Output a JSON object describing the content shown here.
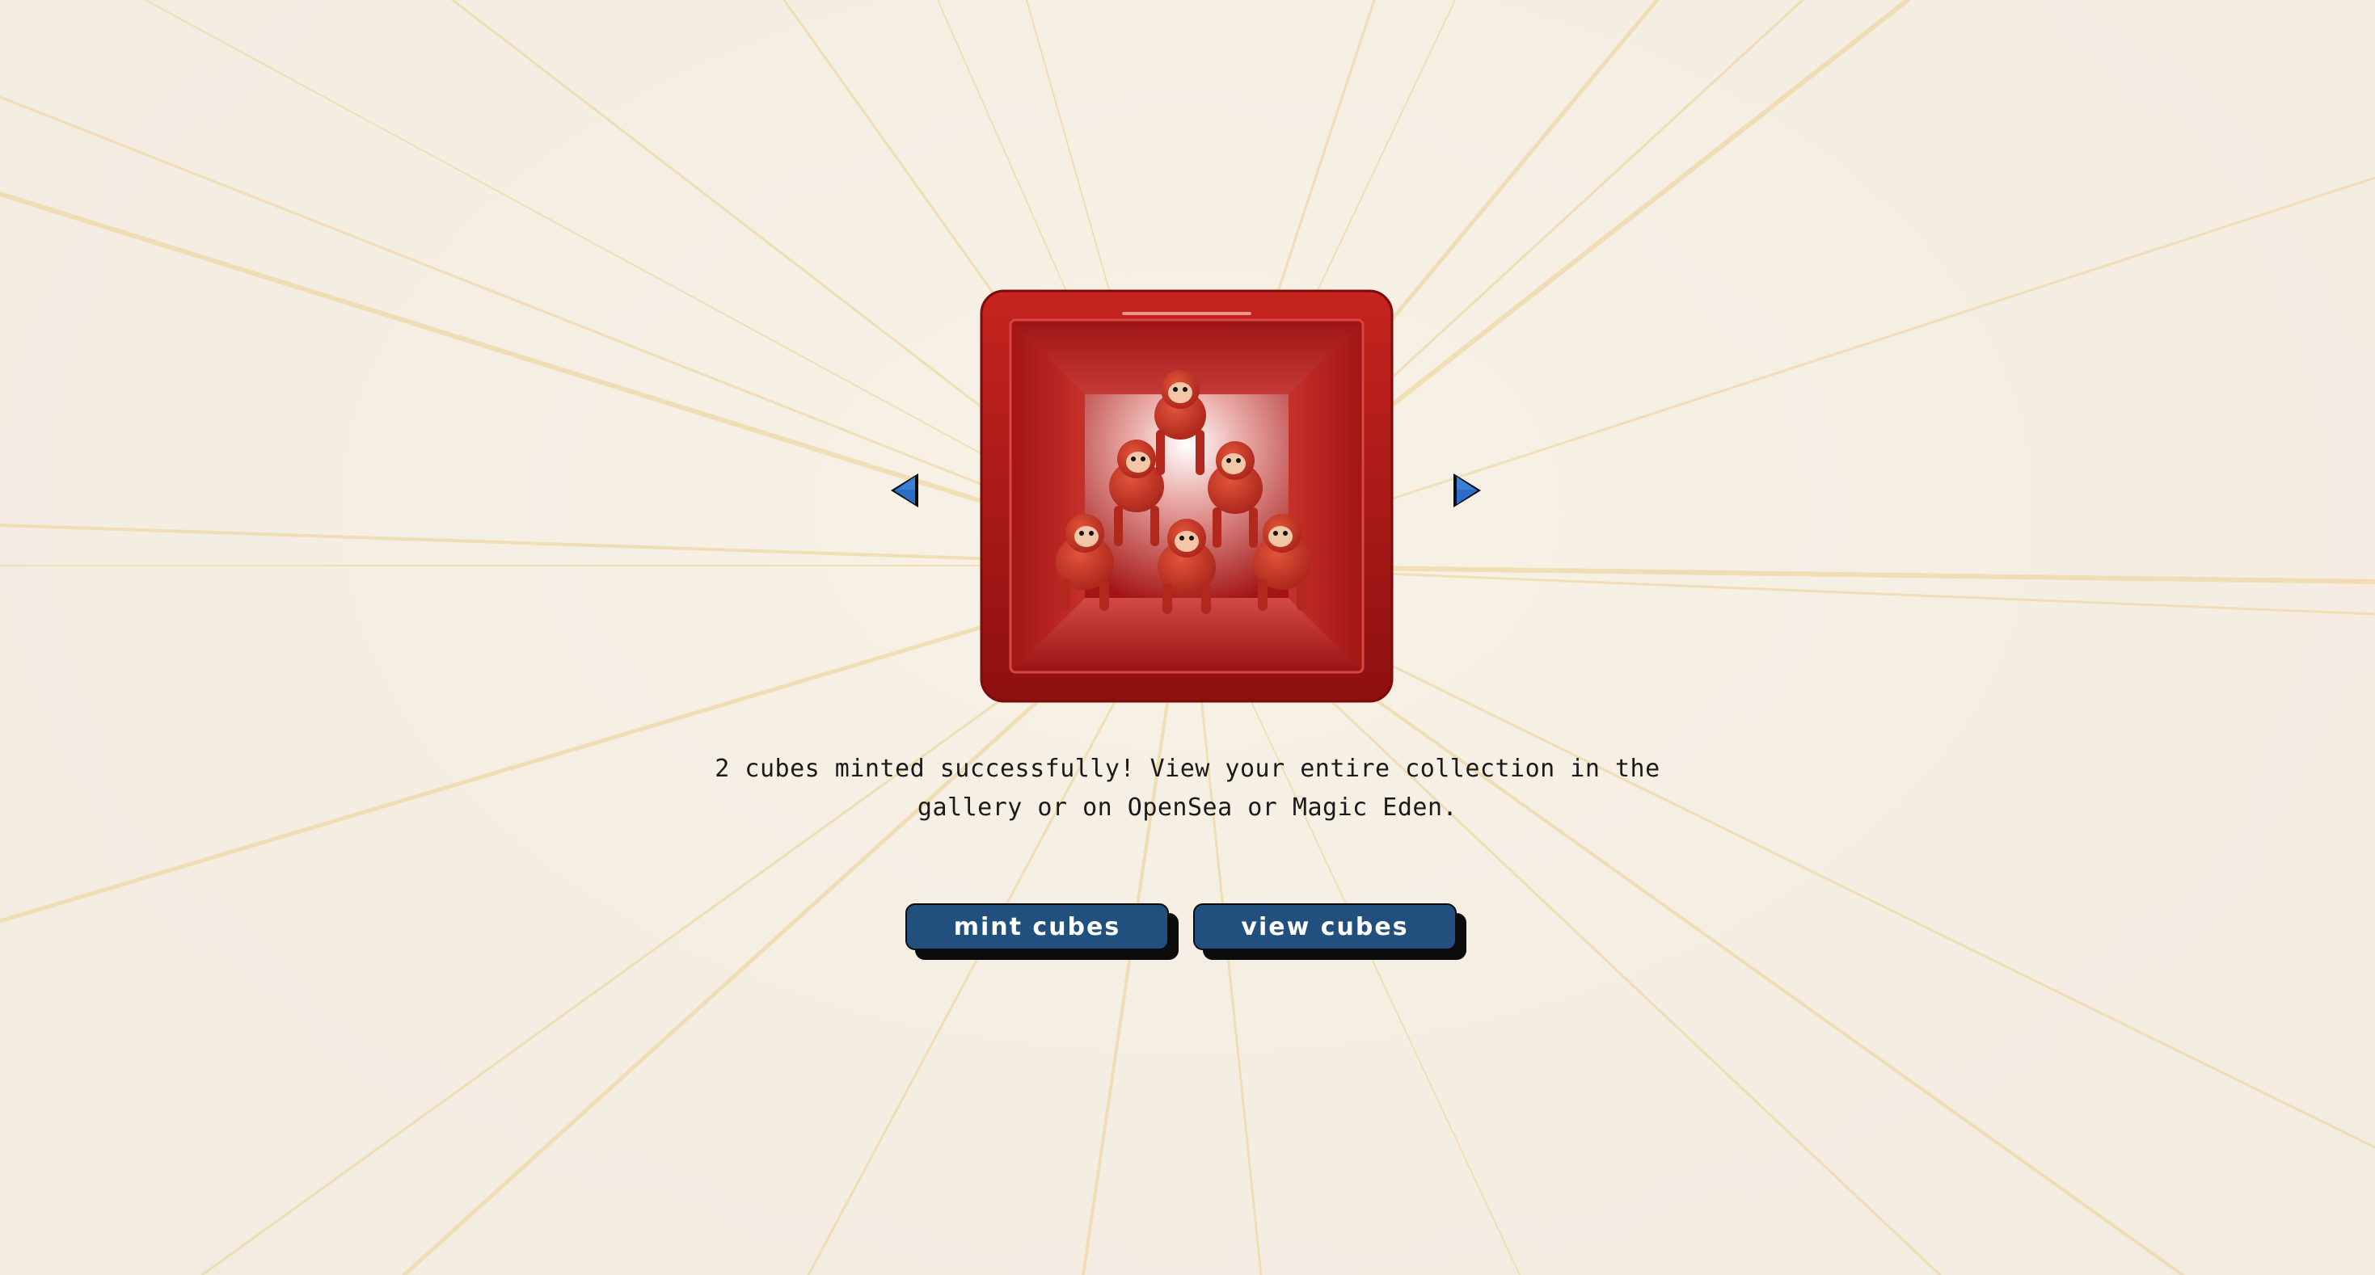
{
  "message": "2 cubes minted successfully! View your entire collection in the gallery or on OpenSea or Magic Eden.",
  "buttons": {
    "mint_label": "MINT CUBES",
    "view_label": "VIEW CUBES"
  },
  "carousel": {
    "prev_icon": "triangle-left-icon",
    "next_icon": "triangle-right-icon",
    "image": "red-cube-with-monkey-pyramid"
  },
  "colors": {
    "background": "#f5efe4",
    "ray": "#f0d9a8",
    "cube_red": "#b71c1c",
    "button_blue": "#22507e",
    "arrow_blue": "#2a6cc7"
  }
}
